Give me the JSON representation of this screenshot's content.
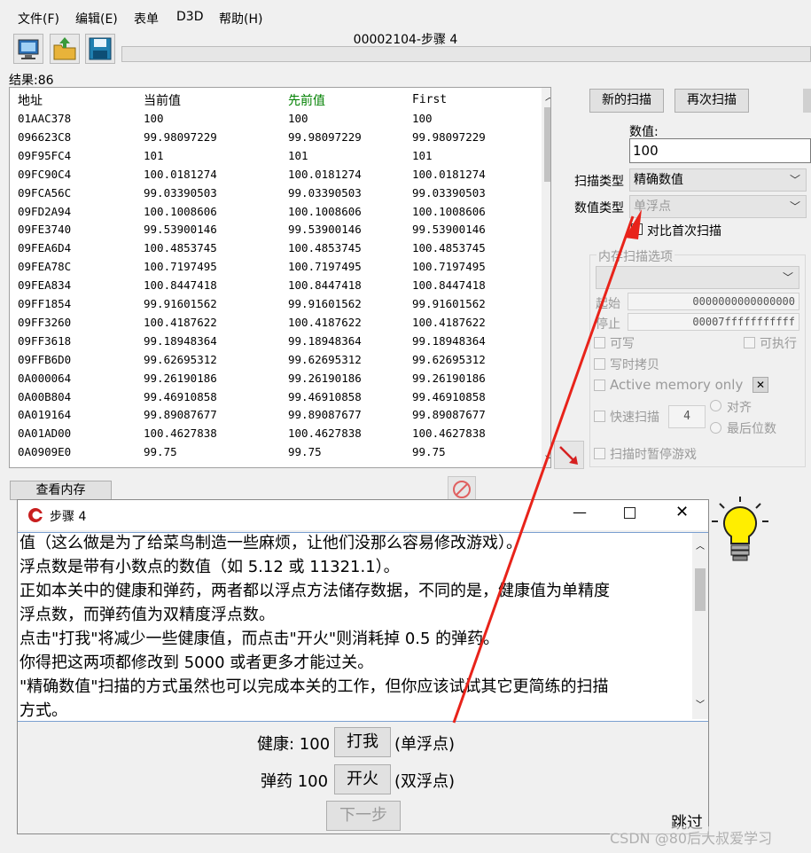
{
  "menu": [
    "文件(F)",
    "编辑(E)",
    "表单",
    "D3D",
    "帮助(H)"
  ],
  "process_title": "00002104-步骤 4",
  "results_label": "结果:86",
  "table": {
    "headers": [
      "地址",
      "当前值",
      "先前值",
      "First"
    ],
    "header_colors": {
      "previous": "#008000"
    },
    "rows": [
      [
        "01AAC378",
        "100",
        "100",
        "100"
      ],
      [
        "096623C8",
        "99.98097229",
        "99.98097229",
        "99.98097229"
      ],
      [
        "09F95FC4",
        "101",
        "101",
        "101"
      ],
      [
        "09FC90C4",
        "100.0181274",
        "100.0181274",
        "100.0181274"
      ],
      [
        "09FCA56C",
        "99.03390503",
        "99.03390503",
        "99.03390503"
      ],
      [
        "09FD2A94",
        "100.1008606",
        "100.1008606",
        "100.1008606"
      ],
      [
        "09FE3740",
        "99.53900146",
        "99.53900146",
        "99.53900146"
      ],
      [
        "09FEA6D4",
        "100.4853745",
        "100.4853745",
        "100.4853745"
      ],
      [
        "09FEA78C",
        "100.7197495",
        "100.7197495",
        "100.7197495"
      ],
      [
        "09FEA834",
        "100.8447418",
        "100.8447418",
        "100.8447418"
      ],
      [
        "09FF1854",
        "99.91601562",
        "99.91601562",
        "99.91601562"
      ],
      [
        "09FF3260",
        "100.4187622",
        "100.4187622",
        "100.4187622"
      ],
      [
        "09FF3618",
        "99.18948364",
        "99.18948364",
        "99.18948364"
      ],
      [
        "09FFB6D0",
        "99.62695312",
        "99.62695312",
        "99.62695312"
      ],
      [
        "0A000064",
        "99.26190186",
        "99.26190186",
        "99.26190186"
      ],
      [
        "0A00B804",
        "99.46910858",
        "99.46910858",
        "99.46910858"
      ],
      [
        "0A019164",
        "99.89087677",
        "99.89087677",
        "99.89087677"
      ],
      [
        "0A01AD00",
        "100.4627838",
        "100.4627838",
        "100.4627838"
      ],
      [
        "0A0909E0",
        "99.75",
        "99.75",
        "99.75"
      ]
    ]
  },
  "view_memory_button": "查看内存",
  "scan": {
    "new_scan": "新的扫描",
    "next_scan": "再次扫描",
    "value_label": "数值:",
    "value": "100",
    "scan_type_label": "扫描类型",
    "scan_type": "精确数值",
    "value_type_label": "数值类型",
    "value_type": "单浮点",
    "compare_first": "对比首次扫描",
    "mem_options_title": "内存扫描选项",
    "start_label": "起始",
    "start_value": "0000000000000000",
    "stop_label": "停止",
    "stop_value": "00007fffffffffff",
    "writable": "可写",
    "executable": "可执行",
    "copy_on_write": "写时拷贝",
    "active_memory": "Active memory only",
    "fast_scan": "快速扫描",
    "fast_scan_value": "4",
    "align": "对齐",
    "last_digits": "最后位数",
    "pause_game": "扫描时暂停游戏"
  },
  "dialog": {
    "title": "步骤 4",
    "text_lines": [
      "值（这么做是为了给菜鸟制造一些麻烦，让他们没那么容易修改游戏）。",
      "浮点数是带有小数点的数值（如 5.12 或 11321.1）。",
      "正如本关中的健康和弹药，两者都以浮点方法储存数据，不同的是，健康值为单精度",
      "浮点数，而弹药值为双精度浮点数。",
      "点击\"打我\"将减少一些健康值，而点击\"开火\"则消耗掉 0.5 的弹药。",
      "你得把这两项都修改到 5000 或者更多才能过关。",
      "\"精确数值\"扫描的方式虽然也可以完成本关的工作，但你应该试试其它更简练的扫描",
      "方式。"
    ],
    "health_label": "健康: 100",
    "hit_button": "打我",
    "health_type": "(单浮点)",
    "ammo_label": "弹药 100",
    "fire_button": "开火",
    "ammo_type": "(双浮点)",
    "next_button": "下一步",
    "skip": "跳过"
  },
  "watermark": "CSDN @80后大叔爱学习",
  "colors": {
    "annotation_arrow": "#e8231a",
    "dialog_border": "#7a9fd0"
  }
}
